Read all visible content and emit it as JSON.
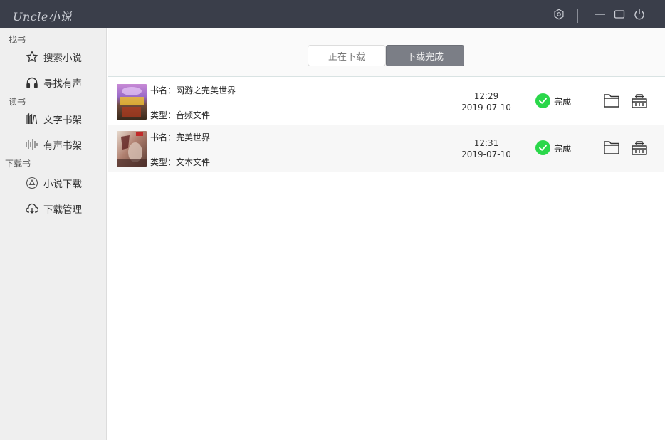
{
  "app": {
    "title": "Uncle小说"
  },
  "sidebar": {
    "sections": [
      {
        "label": "找书",
        "items": [
          {
            "label": "搜索小说",
            "icon": "star-icon"
          },
          {
            "label": "寻找有声",
            "icon": "headphones-icon"
          }
        ]
      },
      {
        "label": "读书",
        "items": [
          {
            "label": "文字书架",
            "icon": "bookshelf-icon"
          },
          {
            "label": "有声书架",
            "icon": "audio-wave-icon"
          }
        ]
      },
      {
        "label": "下载书",
        "items": [
          {
            "label": "小说下载",
            "icon": "download-triangle-icon"
          },
          {
            "label": "下载管理",
            "icon": "cloud-download-icon"
          }
        ]
      }
    ]
  },
  "tabs": {
    "downloading": "正在下载",
    "completed": "下载完成",
    "active": "completed"
  },
  "downloads": [
    {
      "name_label": "书名：网游之完美世界",
      "type_label": "类型：音频文件",
      "time": "12:29",
      "date": "2019-07-10",
      "status": "完成"
    },
    {
      "name_label": "书名：完美世界",
      "type_label": "类型：文本文件",
      "time": "12:31",
      "date": "2019-07-10",
      "status": "完成"
    }
  ],
  "colors": {
    "titlebar": "#3a3e4a",
    "active_tab": "#7b7e86",
    "success": "#2ad74a"
  }
}
